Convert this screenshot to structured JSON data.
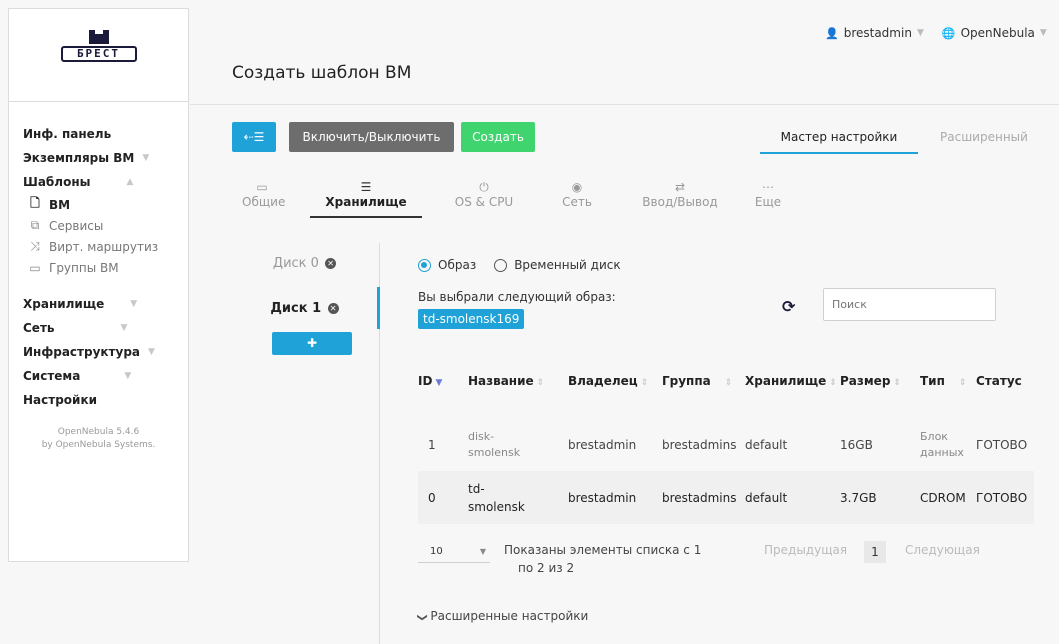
{
  "user": {
    "name": "brestadmin",
    "zone": "OpenNebula",
    "user_icon": "user-icon",
    "zone_icon": "globe-icon"
  },
  "logo": {
    "text": "БРЕСТ"
  },
  "sidebar": {
    "dashboard": "Инф. панель",
    "instances": "Экземпляры ВМ",
    "templates": "Шаблоны",
    "sub": [
      {
        "label": "ВМ",
        "icon": "file-icon"
      },
      {
        "label": "Сервисы",
        "icon": "copy-icon"
      },
      {
        "label": "Вирт. маршрутиз",
        "icon": "shuffle-icon"
      },
      {
        "label": "Группы ВМ",
        "icon": "folder-icon"
      }
    ],
    "storage": "Хранилище",
    "network": "Сеть",
    "infrastructure": "Инфраструктура",
    "system": "Система",
    "settings": "Настройки",
    "footer_version": "OpenNebula 5.4.6",
    "footer_by": "by OpenNebula Systems."
  },
  "page": {
    "title": "Создать шаблон ВМ"
  },
  "toolbar": {
    "toggle_label": "Включить/Выключить",
    "create_label": "Создать"
  },
  "mode": {
    "wizard": "Мастер настройки",
    "advanced": "Расширенный"
  },
  "tabs": [
    {
      "label": "Общие",
      "icon": "laptop-icon"
    },
    {
      "label": "Хранилище",
      "icon": "storage-icon"
    },
    {
      "label": "OS & CPU",
      "icon": "power-icon"
    },
    {
      "label": "Сеть",
      "icon": "globe-icon"
    },
    {
      "label": "Ввод/Вывод",
      "icon": "exchange-icon"
    },
    {
      "label": "Еще",
      "icon": "ellipsis-icon"
    }
  ],
  "disks": [
    {
      "label": "Диск 0"
    },
    {
      "label": "Диск 1"
    }
  ],
  "source": {
    "image": "Образ",
    "volatile": "Временный диск",
    "selected": "image"
  },
  "selection": {
    "label": "Вы выбрали следующий образ:",
    "value": "td-smolensk169"
  },
  "search": {
    "placeholder": "Поиск"
  },
  "table": {
    "headers": [
      "ID",
      "Название",
      "Владелец",
      "Группа",
      "Хранилище",
      "Размер",
      "Тип",
      "Статус"
    ],
    "rows": [
      {
        "id": "1",
        "name_1": "disk-",
        "name_2": "smolensk",
        "owner": "brestadmin",
        "group": "brestadmins",
        "datastore": "default",
        "size": "16GB",
        "type_1": "Блок",
        "type_2": "данных",
        "status": "ГОТОВО"
      },
      {
        "id": "0",
        "name_1": "td-",
        "name_2": "smolensk",
        "owner": "brestadmin",
        "group": "brestadmins",
        "datastore": "default",
        "size": "3.7GB",
        "type_1": "CDROM",
        "type_2": "",
        "status": "ГОТОВО"
      }
    ]
  },
  "pager": {
    "page_size": "10",
    "info_1": "Показаны элементы списка с 1",
    "info_2": "по 2 из 2",
    "prev": "Предыдущая",
    "page": "1",
    "next": "Следующая"
  },
  "advanced_link": "Расширенные настройки",
  "colors": {
    "accent": "#1fa2d8",
    "create": "#3fd46e",
    "toggle": "#6d6d6d"
  }
}
